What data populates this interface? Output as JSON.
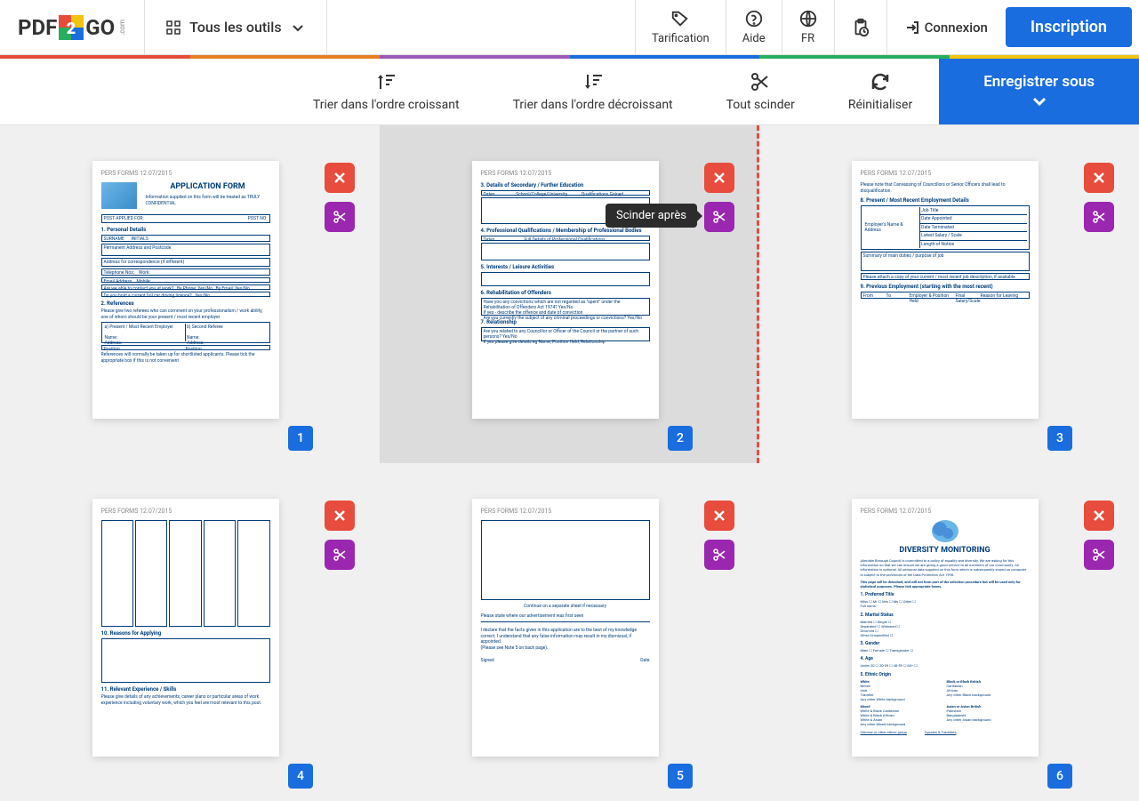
{
  "header": {
    "logo_pdf": "PDF",
    "logo_go": "GO",
    "logo_com": ".com",
    "tools_label": "Tous les outils",
    "pricing": "Tarification",
    "help": "Aide",
    "lang": "FR",
    "login": "Connexion",
    "signup": "Inscription"
  },
  "toolbar": {
    "sort_asc": "Trier dans l'ordre croissant",
    "sort_desc": "Trier dans l'ordre décroissant",
    "split_all": "Tout scinder",
    "reset": "Réinitialiser",
    "save": "Enregistrer sous"
  },
  "tooltip": "Scinder après",
  "pages": [
    {
      "num": "1"
    },
    {
      "num": "2"
    },
    {
      "num": "3"
    },
    {
      "num": "4"
    },
    {
      "num": "5"
    },
    {
      "num": "6"
    }
  ],
  "thumbs": {
    "p1_title": "APPLICATION FORM",
    "p3_section1": "8. Present / Most Recent Employment Details",
    "p3_section2": "9. Previous Employment (starting with the most recent)",
    "p4_section1": "10. Reasons for Applying",
    "p4_section2": "11. Relevant Experience / Skills",
    "p6_title": "DIVERSITY MONITORING",
    "p2_s1": "3. Details of Secondary / Further Education",
    "p2_s2": "4. Professional Qualifications / Membership of Professional Bodies",
    "p2_s3": "5. Interests / Leisure Activities",
    "p2_s4": "6. Rehabilitation of Offenders",
    "p2_s5": "7. Relationship"
  }
}
